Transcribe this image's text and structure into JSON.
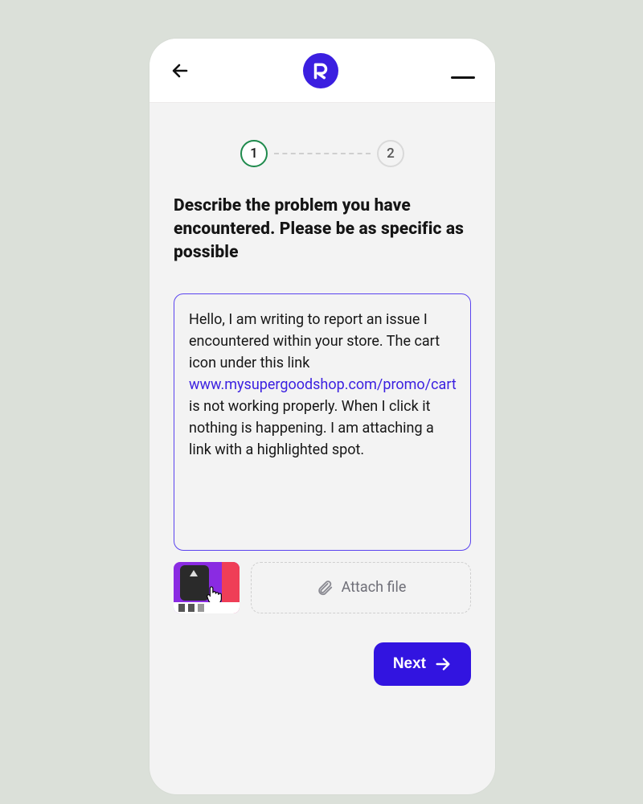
{
  "colors": {
    "brand": "#3b1fe0",
    "primary_button": "#3214e0",
    "step_active_border": "#1e8a4c",
    "link": "#3a1fe0",
    "textbox_border": "#5a43ef"
  },
  "logo_letter": "R",
  "stepper": {
    "current": 1,
    "total": 2,
    "step1_label": "1",
    "step2_label": "2"
  },
  "title": "Describe the problem you have encountered. Please be as specific as possible",
  "message": {
    "before_link": "Hello,  I am writing to report an issue I encountered within your store. The cart icon under this link ",
    "link_text": "www.mysupergoodshop.com/promo/cart",
    "after_link": " is not working properly. When I click it nothing is happening. I am attaching a link with a highlighted spot."
  },
  "attach": {
    "button_label": "Attach file",
    "thumbnail_alt": "screenshot attachment"
  },
  "next_label": "Next"
}
